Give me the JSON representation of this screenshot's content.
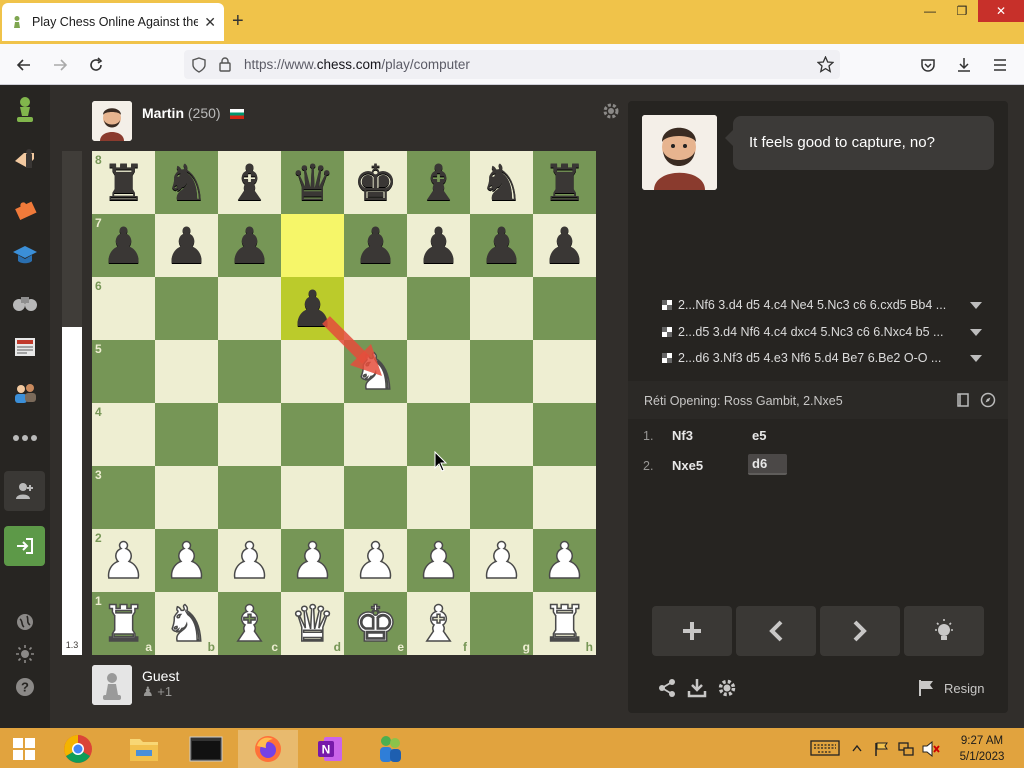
{
  "browser": {
    "tab_title": "Play Chess Online Against the C",
    "url_prefix": "https://www.",
    "url_domain": "chess.com",
    "url_path": "/play/computer"
  },
  "opponent": {
    "name": "Martin",
    "rating": "(250)"
  },
  "player": {
    "name": "Guest",
    "captured": "+1"
  },
  "eval": {
    "label": "1.3",
    "white_fraction": 0.65
  },
  "coach": {
    "message": "It feels good to capture, no?"
  },
  "suggestions": [
    "2...Nf6 3.d4 d5 4.c4 Ne4 5.Nc3 c6 6.cxd5 Bb4 ...",
    "2...d5 3.d4 Nf6 4.c4 dxc4 5.Nc3 c6 6.Nxc4 b5 ...",
    "2...d6 3.Nf3 d5 4.e3 Nf6 5.d4 Be7 6.Be2 O-O ..."
  ],
  "opening": "Réti Opening: Ross Gambit, 2.Nxe5",
  "moves": [
    {
      "num": "1.",
      "white": "Nf3",
      "black": "e5"
    },
    {
      "num": "2.",
      "white": "Nxe5",
      "black": "d6"
    }
  ],
  "board": {
    "ranks": [
      "8",
      "7",
      "6",
      "5",
      "4",
      "3",
      "2",
      "1"
    ],
    "files": [
      "a",
      "b",
      "c",
      "d",
      "e",
      "f",
      "g",
      "h"
    ],
    "position": [
      "rnbqkbnr",
      "ppp.ppp p",
      "...p....",
      "....N...",
      "........",
      "........",
      "PPPPPPPP",
      "RNBQKB.R"
    ],
    "highlights": [
      "d7",
      "d6"
    ]
  },
  "controls": {
    "resign_label": "Resign"
  },
  "taskbar": {
    "time": "9:27 AM",
    "date": "5/1/2023"
  }
}
